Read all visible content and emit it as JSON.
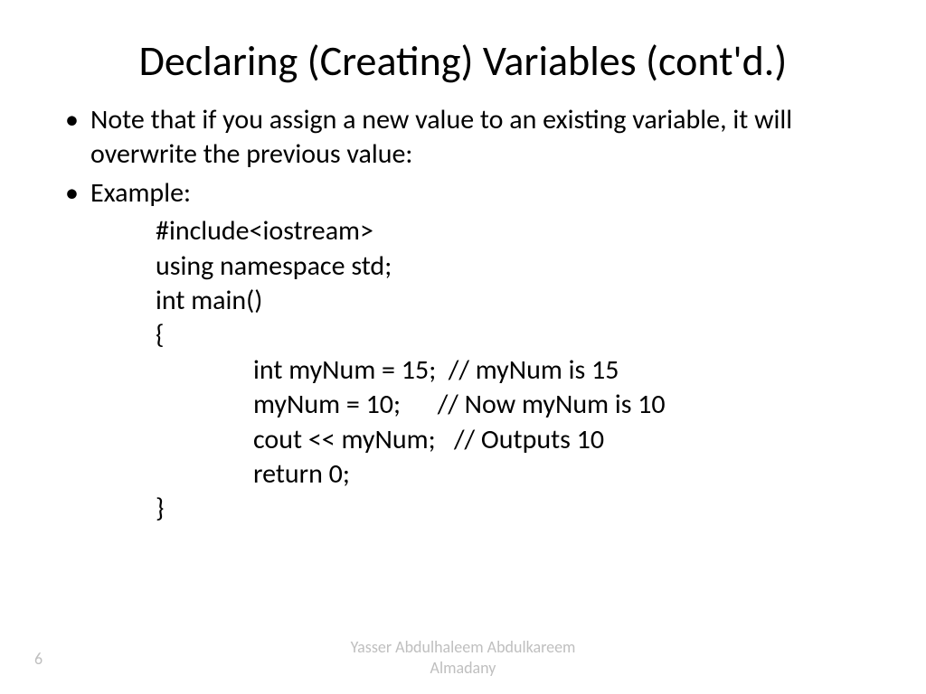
{
  "slide": {
    "title": "Declaring (Creating) Variables (cont'd.)",
    "bullets": [
      "Note that if you assign a new value to an existing variable, it will overwrite the previous value:",
      "Example:"
    ],
    "code": {
      "l1": "#include<iostream>",
      "l2": "using namespace std;",
      "l3": "int main()",
      "l4": "{",
      "l5": "int myNum = 15;  // myNum is 15",
      "l6": "myNum = 10;      // Now myNum is 10",
      "l7": "cout << myNum;   // Outputs 10",
      "l8": "return 0;",
      "l9": "}"
    },
    "page_number": "6",
    "author_line1": "Yasser Abdulhaleem Abdulkareem",
    "author_line2": "Almadany"
  }
}
